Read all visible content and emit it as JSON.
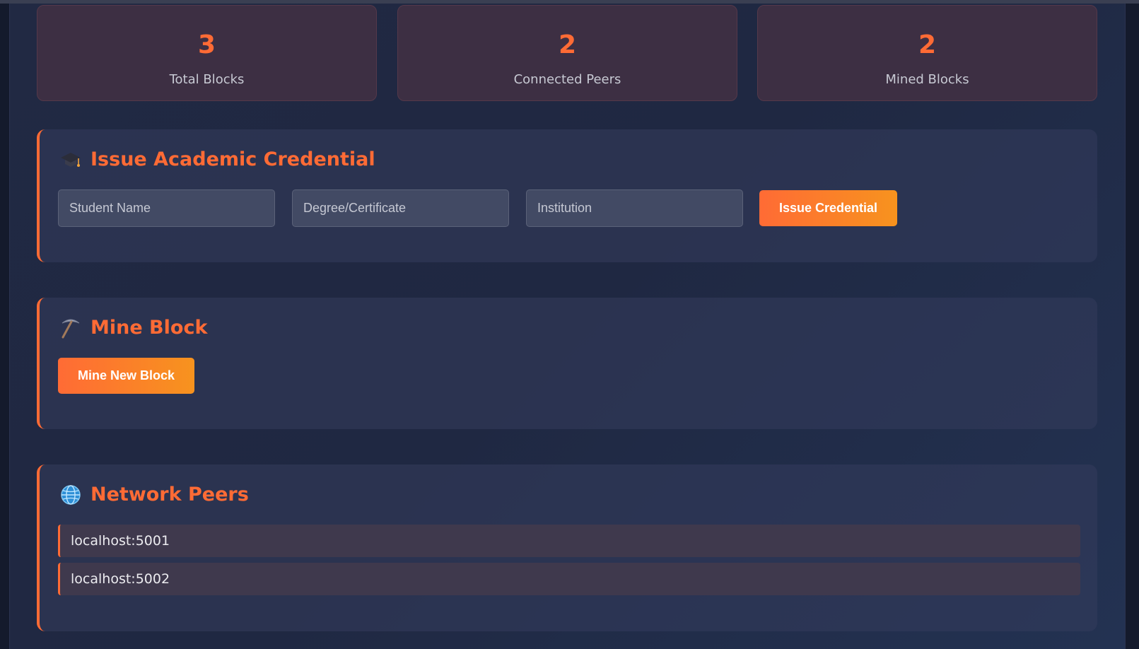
{
  "stats": [
    {
      "value": "3",
      "label": "Total Blocks"
    },
    {
      "value": "2",
      "label": "Connected Peers"
    },
    {
      "value": "2",
      "label": "Mined Blocks"
    }
  ],
  "issue": {
    "icon": "graduation-cap-icon",
    "title": "Issue Academic Credential",
    "student_placeholder": "Student Name",
    "degree_placeholder": "Degree/Certificate",
    "institution_placeholder": "Institution",
    "button": "Issue Credential"
  },
  "mine": {
    "icon": "pickaxe-icon",
    "title": "Mine Block",
    "button": "Mine New Block"
  },
  "peers": {
    "icon": "globe-icon",
    "title": "Network Peers",
    "items": [
      "localhost:5001",
      "localhost:5002"
    ]
  },
  "colors": {
    "accent": "#ff6b35",
    "accent_end": "#f7931e",
    "background": "#1f2842"
  }
}
